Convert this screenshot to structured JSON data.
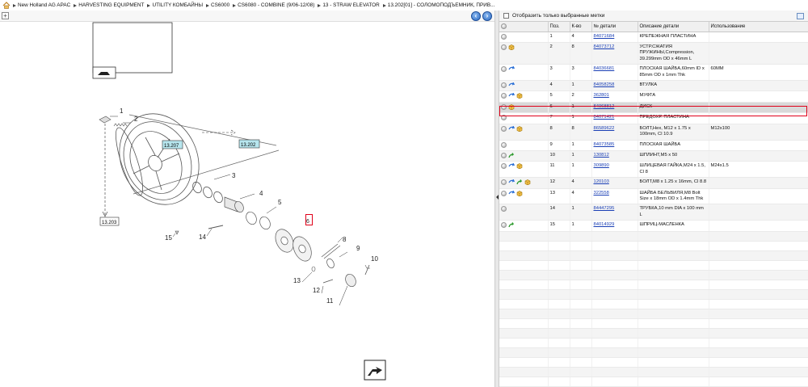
{
  "breadcrumb": {
    "items": [
      "New Holland AG APAC",
      "HARVESTING EQUIPMENT",
      "UTILITY КОМБАЙНЫ",
      "CS6000",
      "CS6080 - COMBINE (9/06-12/08)",
      "13 - STRAW ELEVATOR",
      "13.202[01] - СОЛОМОПОДЪЕМНИК, ПРИВ..."
    ]
  },
  "toolbar": {
    "zoom_glyph": "+",
    "prev_glyph": "‹",
    "next_glyph": "›"
  },
  "diagram": {
    "labels": {
      "ref_13203": "13.203",
      "ref_13207": "13.207",
      "ref_13202": "13.202",
      "c1": "1",
      "c2": "2",
      "c3": "3",
      "c4": "4",
      "c5": "5",
      "c6": "6",
      "c8": "8",
      "c9": "9",
      "c10": "10",
      "c11": "11",
      "c12": "12",
      "c13": "13",
      "c14": "14",
      "c15": "15"
    }
  },
  "filter": {
    "label": "Отобразить только выбранные метки"
  },
  "table": {
    "headers": {
      "pos": "Поз.",
      "qty": "К-во",
      "part_no": "№ детали",
      "description": "Описание детали",
      "usage": "Использование"
    },
    "rows": [
      {
        "icons": [
          "gray"
        ],
        "pos": "1",
        "qty": "4",
        "part_no": "84071684",
        "description": "КРЕПЕЖНАЯ ПЛАСТИНА",
        "usage": ""
      },
      {
        "icons": [
          "gray",
          "box"
        ],
        "pos": "2",
        "qty": "8",
        "part_no": "84073712",
        "description": "УСТР.СЖАТИЯ ПРУЖИНЫ,Compression, 39.299mm OD x 46mm L",
        "usage": ""
      },
      {
        "icons": [
          "gray",
          "blue"
        ],
        "pos": "3",
        "qty": "3",
        "part_no": "84036681",
        "description": "ПЛОСКАЯ ШАЙБА,60mm ID x 85mm OD x 1mm Thk",
        "usage": "60MM"
      },
      {
        "icons": [
          "gray",
          "blue"
        ],
        "pos": "4",
        "qty": "1",
        "part_no": "84058258",
        "description": "ВТУЛКА",
        "usage": ""
      },
      {
        "icons": [
          "gray",
          "blue",
          "box"
        ],
        "pos": "5",
        "qty": "2",
        "part_no": "362801",
        "description": "МУФТА",
        "usage": ""
      },
      {
        "icons": [
          "gray",
          "box"
        ],
        "pos": "6",
        "qty": "1",
        "part_no": "84068812",
        "description": "ДИСК",
        "usage": ""
      },
      {
        "icons": [
          "gray"
        ],
        "pos": "7",
        "qty": "1",
        "part_no": "84071421",
        "description": "ПРЕДОХР. ПЛАСТИНА",
        "usage": ""
      },
      {
        "icons": [
          "gray",
          "blue",
          "box"
        ],
        "pos": "8",
        "qty": "8",
        "part_no": "86589622",
        "description": "БОЛТ,Hex, M12 x 1.75 x 100mm, Cl 10.9",
        "usage": "M12x100"
      },
      {
        "icons": [
          "gray"
        ],
        "pos": "9",
        "qty": "1",
        "part_no": "84073585",
        "description": "ПЛОСКАЯ ШАЙБА",
        "usage": ""
      },
      {
        "icons": [
          "gray",
          "green"
        ],
        "pos": "10",
        "qty": "1",
        "part_no": "130812",
        "description": "ШПЛИНТ,М5 x 50",
        "usage": ""
      },
      {
        "icons": [
          "gray",
          "blue",
          "box"
        ],
        "pos": "11",
        "qty": "1",
        "part_no": "309890",
        "description": "ШЛИЦЕВАЯ ГАЙКА,M24 x 1.5, Cl 8",
        "usage": "M24x1.5"
      },
      {
        "icons": [
          "gray",
          "blue",
          "green",
          "box"
        ],
        "pos": "12",
        "qty": "4",
        "part_no": "120103",
        "description": "БОЛТ,М8 x 1.25 x 16mm, Cl 8.8",
        "usage": ""
      },
      {
        "icons": [
          "gray",
          "blue",
          "box"
        ],
        "pos": "13",
        "qty": "4",
        "part_no": "322558",
        "description": "ШАЙБА БЕЛЬВИЛЯ,M8 Bolt Size x 18mm OD x 1.4mm Thk",
        "usage": ""
      },
      {
        "icons": [
          "gray"
        ],
        "pos": "14",
        "qty": "1",
        "part_no": "84447295",
        "description": "ТРУБКА,10 mm DIA x 100 mm L",
        "usage": ""
      },
      {
        "icons": [
          "gray",
          "green"
        ],
        "pos": "15",
        "qty": "1",
        "part_no": "84014929",
        "description": "ШПРИЦ-МАСЛЕНКА",
        "usage": ""
      }
    ],
    "selected_pos": "6"
  }
}
